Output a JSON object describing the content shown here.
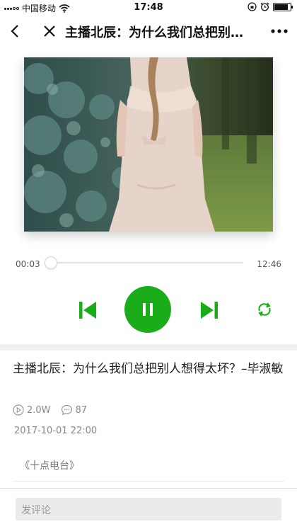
{
  "status_bar": {
    "carrier": "中国移动",
    "time": "17:48",
    "battery_level": 0.85
  },
  "nav": {
    "title": "主播北辰：为什么我们总把别人想得太坏？–毕淑敏",
    "icons": {
      "back": "back-arrow-icon",
      "close": "close-icon",
      "more": "more-icon"
    }
  },
  "player": {
    "current_time": "00:03",
    "total_time": "12:46",
    "progress": 0.004,
    "state": "playing",
    "accent_color": "#1aad19"
  },
  "article": {
    "title": "主播北辰：为什么我们总把别人想得太坏？–毕淑敏",
    "plays": "2.0W",
    "comments": "87",
    "date": "2017-10-01 22:00",
    "album": "《十点电台》"
  },
  "comment_input": {
    "placeholder": "发评论"
  }
}
